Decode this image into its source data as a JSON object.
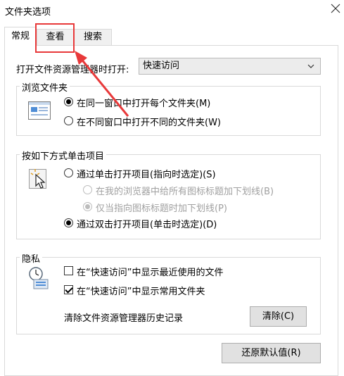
{
  "window": {
    "title": "文件夹选项",
    "close_icon": "×"
  },
  "tabs": [
    {
      "label": "常规",
      "active": true
    },
    {
      "label": "查看",
      "active": false
    },
    {
      "label": "搜索",
      "active": false
    }
  ],
  "open_explorer": {
    "label": "打开文件资源管理器时打开:",
    "value": "快速访问",
    "chevron": "﹀"
  },
  "browse": {
    "legend": "浏览文件夹",
    "options": [
      {
        "label": "在同一窗口中打开每个文件夹(M)",
        "checked": true
      },
      {
        "label": "在不同窗口中打开不同的文件夹(W)",
        "checked": false
      }
    ]
  },
  "click": {
    "legend": "按如下方式单击项目",
    "single": {
      "label": "通过单击打开项目(指向时选定)(S)",
      "checked": false
    },
    "underline_all": {
      "label": "在我的浏览器中给所有图标标题加下划线(B)",
      "checked": false,
      "disabled": true
    },
    "underline_hover": {
      "label": "仅当指向图标标题时加下划线(P)",
      "checked": true,
      "disabled": true
    },
    "double": {
      "label": "通过双击打开项目(单击时选定)(D)",
      "checked": true
    }
  },
  "privacy": {
    "legend": "隐私",
    "recent": {
      "label": "在“快速访问”中显示最近使用的文件",
      "checked": false
    },
    "frequent": {
      "label": "在“快速访问”中显示常用文件夹",
      "checked": true
    },
    "clear_label": "清除文件资源管理器历史记录",
    "clear_button": "清除(C)"
  },
  "restore_button": "还原默认值(R)",
  "colors": {
    "annotation": "#e8393a",
    "border": "#d9d9d9",
    "button": "#e1e1e1"
  }
}
